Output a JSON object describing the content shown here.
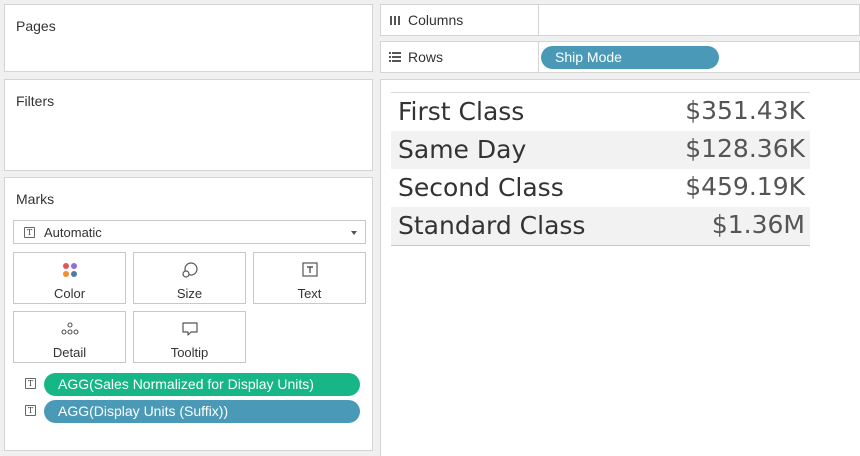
{
  "pages": {
    "title": "Pages"
  },
  "filters": {
    "title": "Filters"
  },
  "marks": {
    "title": "Marks",
    "mark_type": "Automatic",
    "buttons": [
      {
        "label": "Color",
        "icon": "color-dots-icon"
      },
      {
        "label": "Size",
        "icon": "size-icon"
      },
      {
        "label": "Text",
        "icon": "text-icon"
      },
      {
        "label": "Detail",
        "icon": "detail-icon"
      },
      {
        "label": "Tooltip",
        "icon": "tooltip-icon"
      }
    ],
    "fields": [
      {
        "label": "AGG(Sales Normalized for Display Units)",
        "color": "#16b686"
      },
      {
        "label": "AGG(Display Units (Suffix))",
        "color": "#4a9ab7"
      }
    ]
  },
  "shelves": {
    "columns_label": "Columns",
    "rows_label": "Rows",
    "rows_pill": "Ship Mode"
  },
  "view": {
    "rows": [
      {
        "label": "First Class",
        "value": "$351.43K"
      },
      {
        "label": "Same Day",
        "value": "$128.36K"
      },
      {
        "label": "Second Class",
        "value": "$459.19K"
      },
      {
        "label": "Standard Class",
        "value": "$1.36M"
      }
    ]
  },
  "colors": {
    "green_pill": "#16b686",
    "blue_pill": "#4a9ab7"
  }
}
